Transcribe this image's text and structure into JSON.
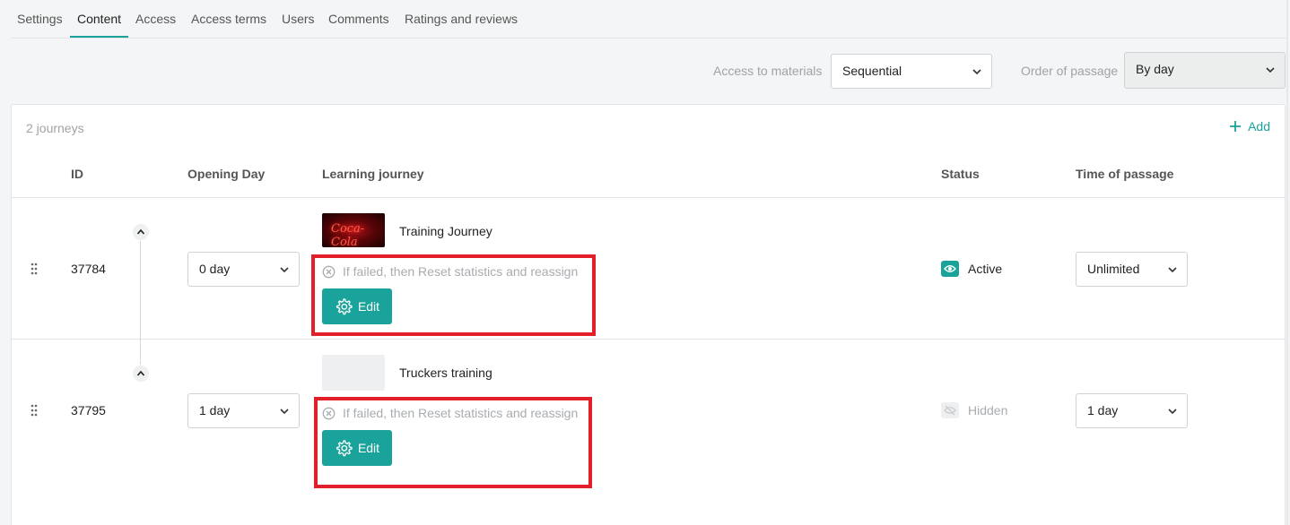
{
  "tabs": [
    "Settings",
    "Content",
    "Access",
    "Access terms",
    "Users",
    "Comments",
    "Ratings and reviews"
  ],
  "active_tab": "Content",
  "filters": {
    "access_label": "Access to materials",
    "access_value": "Sequential",
    "order_label": "Order of passage",
    "order_value": "By day"
  },
  "list": {
    "count": "2 journeys",
    "add_label": "Add",
    "columns": {
      "id": "ID",
      "opening_day": "Opening Day",
      "learning_journey": "Learning journey",
      "status": "Status",
      "time_of_passage": "Time of passage"
    },
    "rows": [
      {
        "id": "37784",
        "opening_day": "0 day",
        "journey": "Training Journey",
        "thumb_text": "Coca-Cola",
        "fail_text": "If failed, then Reset statistics and reassign",
        "edit_label": "Edit",
        "status": "Active",
        "time_of_passage": "Unlimited"
      },
      {
        "id": "37795",
        "opening_day": "1 day",
        "journey": "Truckers training",
        "fail_text": "If failed, then Reset statistics and reassign",
        "edit_label": "Edit",
        "status": "Hidden",
        "time_of_passage": "1 day"
      }
    ]
  },
  "colors": {
    "accent": "#1aa39a",
    "highlight": "#e3202a",
    "muted": "#a8acb0"
  },
  "icons": [
    "chevron-down-icon",
    "plus-icon",
    "drag-handle-icon",
    "chevron-up-icon",
    "cancel-circle-icon",
    "gear-icon",
    "eye-icon",
    "eye-off-icon"
  ]
}
